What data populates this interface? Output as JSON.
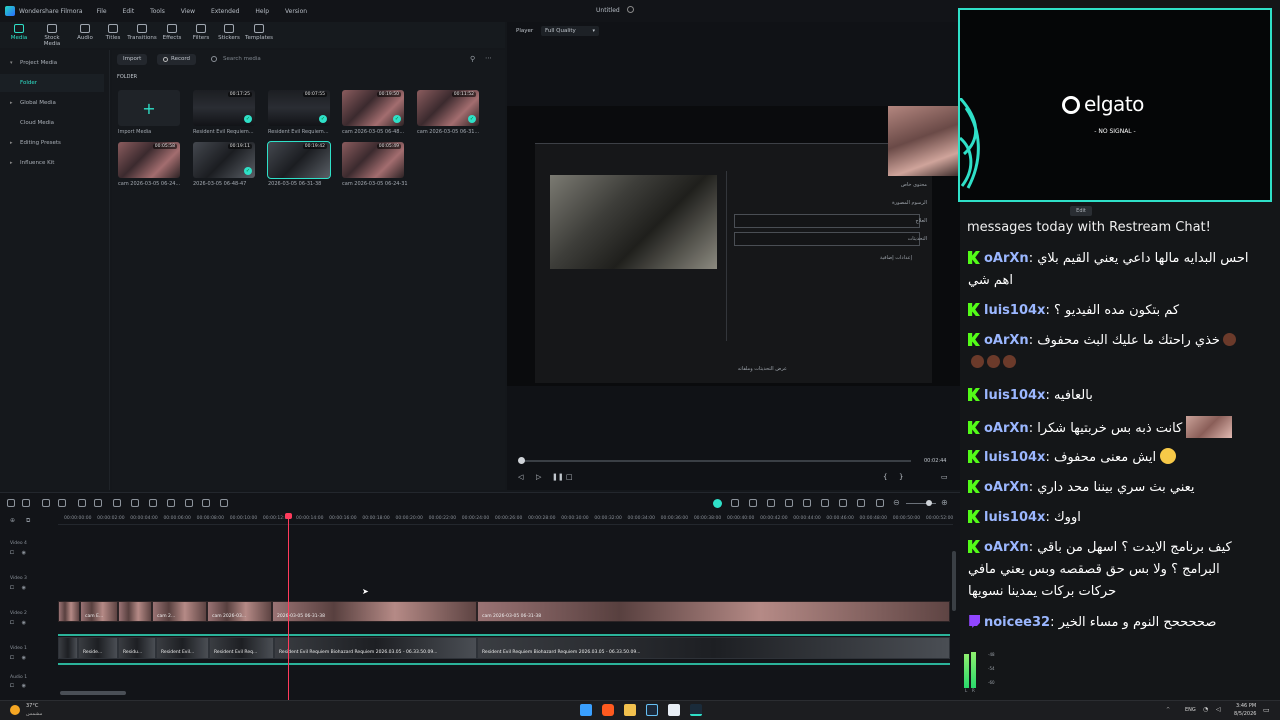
{
  "filmora": {
    "app_name": "Wondershare Filmora",
    "menu": [
      "File",
      "Edit",
      "Tools",
      "View",
      "Extended",
      "Help",
      "Version"
    ],
    "doc_title": "Untitled",
    "toolbar": [
      "Media",
      "Stock Media",
      "Audio",
      "Titles",
      "Transitions",
      "Effects",
      "Filters",
      "Stickers",
      "Templates"
    ],
    "sidebar": [
      {
        "label": "Project Media"
      },
      {
        "label": "Folder"
      },
      {
        "label": "Global Media"
      },
      {
        "label": "Cloud Media"
      },
      {
        "label": "Editing Presets"
      },
      {
        "label": "Influence Kit"
      }
    ],
    "media_bar": {
      "import_label": "Import",
      "record_label": "Record",
      "search_placeholder": "Search media"
    },
    "folder_label": "FOLDER",
    "media_items": [
      {
        "label": "Import Media",
        "duration": ""
      },
      {
        "label": "Resident Evil Requiem...",
        "duration": "00:17:25"
      },
      {
        "label": "Resident Evil Requiem...",
        "duration": "00:07:55"
      },
      {
        "label": "cam 2026-03-05 06-48...",
        "duration": "00:19:50"
      },
      {
        "label": "cam 2026-03-05 06-31...",
        "duration": "00:11:52"
      },
      {
        "label": "cam 2026-03-05 06-24...",
        "duration": "00:05:58"
      },
      {
        "label": "2026-03-05 06-48-47",
        "duration": "00:19:11"
      },
      {
        "label": "2026-03-05 06-31-38",
        "duration": "00:19:42"
      },
      {
        "label": "cam 2026-03-05 06-24-31",
        "duration": "00:05:49"
      }
    ],
    "player": {
      "label": "Player",
      "quality": "Full Quality",
      "time": "00:02:44"
    },
    "game_menu": [
      "محتوى خاص",
      "الرسوم المصورة",
      "العلاج",
      "التحديثات",
      "إعدادات إضافية"
    ],
    "game_footer": "عرض التحديثات وملفاته",
    "timeline": {
      "ruler": [
        "00:00:00:00",
        "00:00:02:00",
        "00:00:04:00",
        "00:00:06:00",
        "00:00:08:00",
        "00:00:10:00",
        "00:00:12:00",
        "00:00:14:00",
        "00:00:16:00",
        "00:00:18:00",
        "00:00:20:00",
        "00:00:22:00",
        "00:00:24:00",
        "00:00:26:00",
        "00:00:28:00",
        "00:00:30:00",
        "00:00:32:00",
        "00:00:34:00",
        "00:00:36:00",
        "00:00:38:00",
        "00:00:40:00",
        "00:00:42:00",
        "00:00:44:00",
        "00:00:46:00",
        "00:00:48:00",
        "00:00:50:00",
        "00:00:52:00"
      ],
      "tracks": [
        "Video 4",
        "Video 3",
        "Video 2",
        "Video 1",
        "Audio 1"
      ],
      "cam_clips": [
        "cam E...",
        "cam 2...",
        "cam 2026-03...",
        "cam 2026-03-05 06-...",
        "2026-03-05 06-31-38",
        "cam 2026-03-05 06-31-38"
      ],
      "game_clips": [
        "Reside...",
        "Residu...",
        "Resident Evil...",
        "Resident Evil Req...",
        "Resident Evil Requiem Biohazard Requiem 2026.03.05 - 06.33.50.09...",
        "Resident Evil Requiem Biohazard Requiem 2026.03.05 - 06.33.50.09..."
      ]
    }
  },
  "elgato": {
    "brand": "elgato",
    "status": "- NO SIGNAL -",
    "edit_label": "Edit"
  },
  "chat": {
    "header": "messages today with Restream Chat!",
    "messages": [
      {
        "platform": "kick",
        "user": "oArXn",
        "text": "احس البدايه مالها داعي يعني القيم بلاي اهم شي"
      },
      {
        "platform": "kick",
        "user": "luis104x",
        "text": "كم بتكون مده الفيديو ؟"
      },
      {
        "platform": "kick",
        "user": "oArXn",
        "text": "خذي راحتك ما عليك البث محفوف"
      },
      {
        "platform": "kick",
        "user": "luis104x",
        "text": "بالعافيه"
      },
      {
        "platform": "kick",
        "user": "oArXn",
        "text": "كانت ذبه بس خربتيها شكرا"
      },
      {
        "platform": "kick",
        "user": "luis104x",
        "text": "ايش معنى محفوف"
      },
      {
        "platform": "kick",
        "user": "oArXn",
        "text": "يعني بث سري بيننا محد داري"
      },
      {
        "platform": "kick",
        "user": "luis104x",
        "text": "اووك"
      },
      {
        "platform": "kick",
        "user": "oArXn",
        "text": "كيف برنامج الايدت ؟ اسهل من باقي البرامج ؟ ولا بس حق قصقصه وبس يعني مافي حركات بركات يمدينا نسويها"
      },
      {
        "platform": "twitch",
        "user": "noicee32",
        "text": "صححححح النوم و مساء الخير"
      }
    ],
    "colors": {
      "kick": "#53fc18",
      "twitch": "#9146ff",
      "user": "#9bb7ff"
    }
  },
  "meter": {
    "labels": [
      "-48",
      "-54",
      "-60"
    ],
    "channels": [
      "L",
      "R"
    ]
  },
  "taskbar": {
    "weather_temp": "37°C",
    "weather_desc": "مشمس",
    "lang": "ENG",
    "time": "3:46 PM",
    "date": "8/5/2026"
  },
  "accent": "#2fe0c8"
}
